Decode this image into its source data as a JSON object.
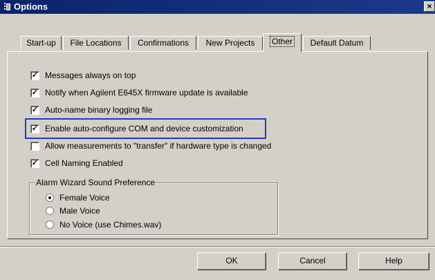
{
  "window": {
    "title": "Options",
    "close_glyph": "×"
  },
  "tabs": [
    {
      "label": "Start-up",
      "active": false
    },
    {
      "label": "File Locations",
      "active": false
    },
    {
      "label": "Confirmations",
      "active": false
    },
    {
      "label": "New Projects",
      "active": false
    },
    {
      "label": "Other",
      "active": true
    },
    {
      "label": "Default Datum",
      "active": false
    }
  ],
  "options": [
    {
      "label": "Messages always on top",
      "checked": true
    },
    {
      "label": "Notify when Agilent E645X firmware update is available",
      "checked": true
    },
    {
      "label": "Auto-name binary logging file",
      "checked": true
    },
    {
      "label": "Enable auto-configure COM and device customization",
      "checked": true
    },
    {
      "label": "Allow measurements to \"transfer\" if hardware type is changed",
      "checked": false
    },
    {
      "label": "Cell Naming Enabled",
      "checked": true
    }
  ],
  "alarm_group": {
    "title": "Alarm Wizard Sound Preference",
    "choices": [
      {
        "label": "Female Voice",
        "selected": true
      },
      {
        "label": "Male Voice",
        "selected": false
      },
      {
        "label": "No Voice (use Chimes.wav)",
        "selected": false
      }
    ]
  },
  "buttons": {
    "ok": "OK",
    "cancel": "Cancel",
    "help": "Help"
  },
  "colors": {
    "titlebar": "#0a246a",
    "highlight_border": "#1c39c8",
    "face": "#d4d0c8"
  },
  "icons": {
    "window": "options-window-icon",
    "close": "close-icon"
  }
}
